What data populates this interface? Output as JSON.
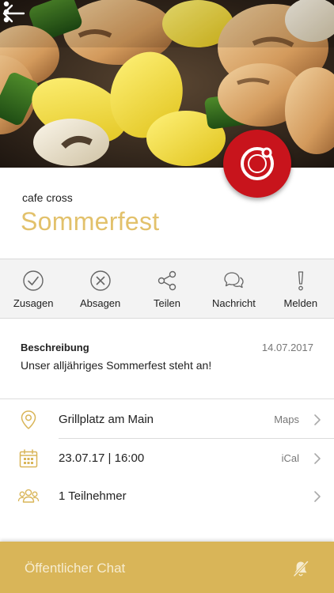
{
  "header": {
    "organizer": "cafe cross",
    "title": "Sommerfest"
  },
  "actions": [
    {
      "label": "Zusagen",
      "icon": "check-circle-icon"
    },
    {
      "label": "Absagen",
      "icon": "x-circle-icon"
    },
    {
      "label": "Teilen",
      "icon": "share-icon"
    },
    {
      "label": "Nachricht",
      "icon": "chat-bubbles-icon"
    },
    {
      "label": "Melden",
      "icon": "exclamation-icon"
    }
  ],
  "description": {
    "heading": "Beschreibung",
    "date": "14.07.2017",
    "text": "Unser alljähriges Sommerfest steht an!"
  },
  "details": [
    {
      "text": "Grillplatz am Main",
      "aux": "Maps",
      "icon": "location-pin-icon"
    },
    {
      "text": "23.07.17 | 16:00",
      "aux": "iCal",
      "icon": "calendar-icon"
    },
    {
      "text": "1 Teilnehmer",
      "aux": "",
      "icon": "group-icon"
    }
  ],
  "chat": {
    "label": "Öffentlicher Chat",
    "icon": "bell-muted-icon"
  },
  "colors": {
    "accent": "#e2c16b",
    "chat_bar": "#d9b558",
    "badge": "#c8141c"
  }
}
